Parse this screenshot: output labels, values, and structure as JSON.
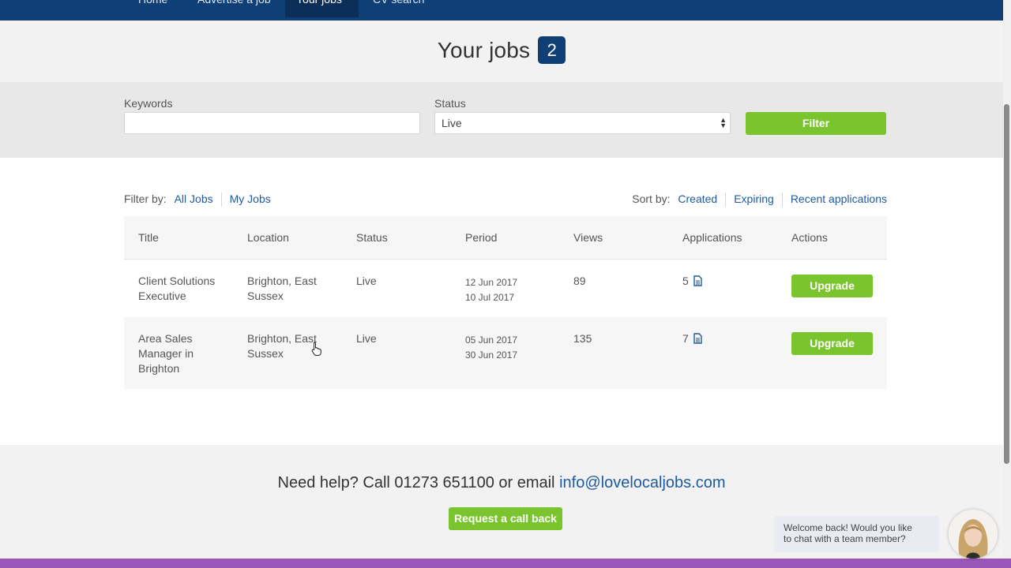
{
  "nav": {
    "tabs": [
      {
        "label": "Home"
      },
      {
        "label": "Advertise a job"
      },
      {
        "label": "Your jobs",
        "active": true
      },
      {
        "label": "CV search"
      }
    ]
  },
  "header": {
    "title": "Your jobs",
    "count": "2"
  },
  "filters": {
    "keywords_label": "Keywords",
    "keywords_value": "",
    "status_label": "Status",
    "status_value": "Live",
    "filter_button": "Filter"
  },
  "filter_by": {
    "label": "Filter by:",
    "options": [
      "All Jobs",
      "My Jobs"
    ]
  },
  "sort_by": {
    "label": "Sort by:",
    "options": [
      "Created",
      "Expiring",
      "Recent applications"
    ]
  },
  "table": {
    "columns": [
      "Title",
      "Location",
      "Status",
      "Period",
      "Views",
      "Applications",
      "Actions"
    ],
    "rows": [
      {
        "title_line1": "Client Solutions",
        "title_line2": "Executive",
        "title_line3": "",
        "location_line1": "Brighton, East",
        "location_line2": "Sussex",
        "status": "Live",
        "period_start": "12 Jun 2017",
        "period_end": "10 Jul 2017",
        "views": "89",
        "applications": "5",
        "action": "Upgrade"
      },
      {
        "title_line1": "Area Sales",
        "title_line2": "Manager in",
        "title_line3": "Brighton",
        "location_line1": "Brighton, East",
        "location_line2": "Sussex",
        "status": "Live",
        "period_start": "05 Jun 2017",
        "period_end": "30 Jun 2017",
        "views": "135",
        "applications": "7",
        "action": "Upgrade"
      }
    ]
  },
  "footer": {
    "help_text": "Need help? Call 01273 651100 or email",
    "email": "info@lovelocaljobs.com",
    "callback_button": "Request a call back"
  },
  "chat": {
    "line1": "Welcome back! Would you like",
    "line2": "to chat with a team member?"
  },
  "colors": {
    "nav": "#0f3f75",
    "accent_green": "#7ac52d",
    "link": "#1e5a9c",
    "footer_bar": "#9a57b9"
  }
}
